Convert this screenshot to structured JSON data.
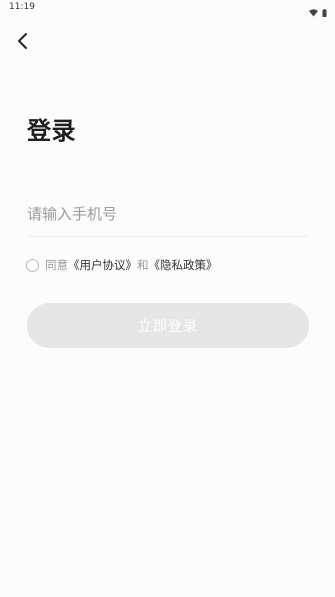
{
  "status_bar": {
    "time": "11:19",
    "icons": [
      "wifi-icon",
      "battery-icon"
    ]
  },
  "header": {
    "back_icon": "chevron-left-icon"
  },
  "main": {
    "title": "登录",
    "phone": {
      "value": "",
      "placeholder": "请输入手机号"
    },
    "agreement": {
      "checked": false,
      "prefix": "同意",
      "user_agreement": "《用户协议》",
      "and": "和",
      "privacy_policy": "《隐私政策》"
    },
    "login_button": {
      "label": "立即登录",
      "enabled": false
    }
  },
  "colors": {
    "background": "#fcfcfc",
    "title": "#1f1f1f",
    "placeholder": "#9a9a9a",
    "muted_text": "#999999",
    "link_text": "#333333",
    "button_disabled_bg": "#e6e6e6",
    "button_text": "#ffffff"
  }
}
